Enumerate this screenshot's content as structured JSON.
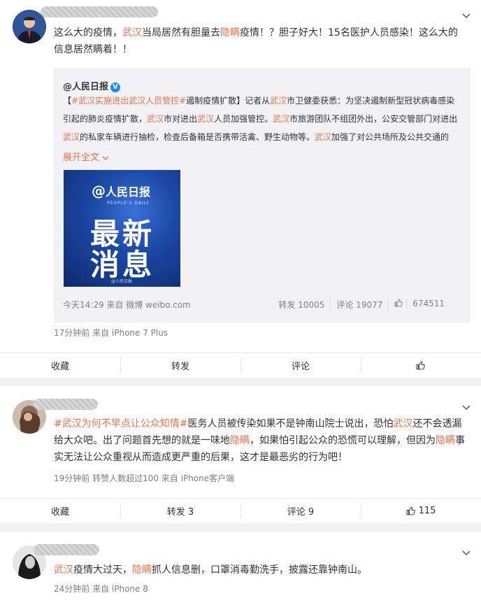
{
  "colors": {
    "highlight": "#eb7350",
    "meta": "#808080",
    "page_bg": "#f2f2f5"
  },
  "post1": {
    "text_parts": [
      {
        "t": "这么大的疫情，",
        "h": false
      },
      {
        "t": "武汉",
        "h": true
      },
      {
        "t": "当局居然有胆量去",
        "h": false
      },
      {
        "t": "隐瞒",
        "h": true
      },
      {
        "t": "疫情！？胆子好大！15名医护人员感染！这么大的信息居然瞒着！！",
        "h": false
      }
    ],
    "repost": {
      "author": "@人民日报",
      "verified_icon": "verified-v-icon",
      "text_parts": [
        {
          "t": "【",
          "h": false
        },
        {
          "t": "#武汉实施进出武汉人员管控#",
          "h": true
        },
        {
          "t": "遏制疫情扩散】记者从",
          "h": false
        },
        {
          "t": "武汉",
          "h": true
        },
        {
          "t": "市卫健委获悉：为坚决遏制新型冠状病毒感染引起的肺炎疫情扩散，",
          "h": false
        },
        {
          "t": "武汉",
          "h": true
        },
        {
          "t": "市对进出",
          "h": false
        },
        {
          "t": "武汉",
          "h": true
        },
        {
          "t": "人员加强管控。",
          "h": false
        },
        {
          "t": "武汉",
          "h": true
        },
        {
          "t": "市旅游团队不组团外出，公安交管部门对进出",
          "h": false
        },
        {
          "t": "武汉",
          "h": true
        },
        {
          "t": "的私家车辆进行抽检，检查后备箱是否携带活禽、野生动物等。",
          "h": false
        },
        {
          "t": "武汉",
          "h": true
        },
        {
          "t": "加强了对公共场所及公共交通的",
          "h": false
        }
      ],
      "expand_label": "展开全文",
      "image": {
        "brand": "人民日报",
        "brand_sub": "PEOPLE'S DAILY",
        "line1": "最新",
        "line2": "消息",
        "footer": "@人民日报"
      },
      "time": "今天14:29 来自 微博 weibo.com",
      "repost_label": "转发 10005",
      "comment_label": "评论 19077",
      "like_count": "674511"
    },
    "meta": "17分钟前  来自 iPhone 7 Plus",
    "actions": {
      "fav": "收藏",
      "repost": "转发",
      "comment": "评论",
      "like": ""
    }
  },
  "post2": {
    "text_parts": [
      {
        "t": "#武汉为何不早点让公众知情#",
        "h": true
      },
      {
        "t": "医务人员被传染如果不是钟南山院士说出，恐怕",
        "h": false
      },
      {
        "t": "武汉",
        "h": true
      },
      {
        "t": "还不会透漏给大众吧。出了问题首先想的就是一味地",
        "h": false
      },
      {
        "t": "隐瞒",
        "h": true
      },
      {
        "t": "，如果怕引起公众的恐慌可以理解，但因为",
        "h": false
      },
      {
        "t": "隐瞒",
        "h": true
      },
      {
        "t": "事实无法让公众重视从而造成更严重的后果，这才是最恶劣的行为吧！",
        "h": false
      }
    ],
    "meta": "19分钟前  转赞人数超过100  来自 iPhone客户端",
    "actions": {
      "fav": "收藏",
      "repost": "转发 3",
      "comment": "评论 9",
      "like": "115"
    }
  },
  "post3": {
    "text_parts": [
      {
        "t": "武汉",
        "h": true
      },
      {
        "t": "疫情大过天，",
        "h": false
      },
      {
        "t": "隐瞒",
        "h": true
      },
      {
        "t": "抓人信息删，口罩消毒勤洗手，披露还靠钟南山。",
        "h": false
      }
    ],
    "meta": "24分钟前  来自 iPhone 8"
  }
}
